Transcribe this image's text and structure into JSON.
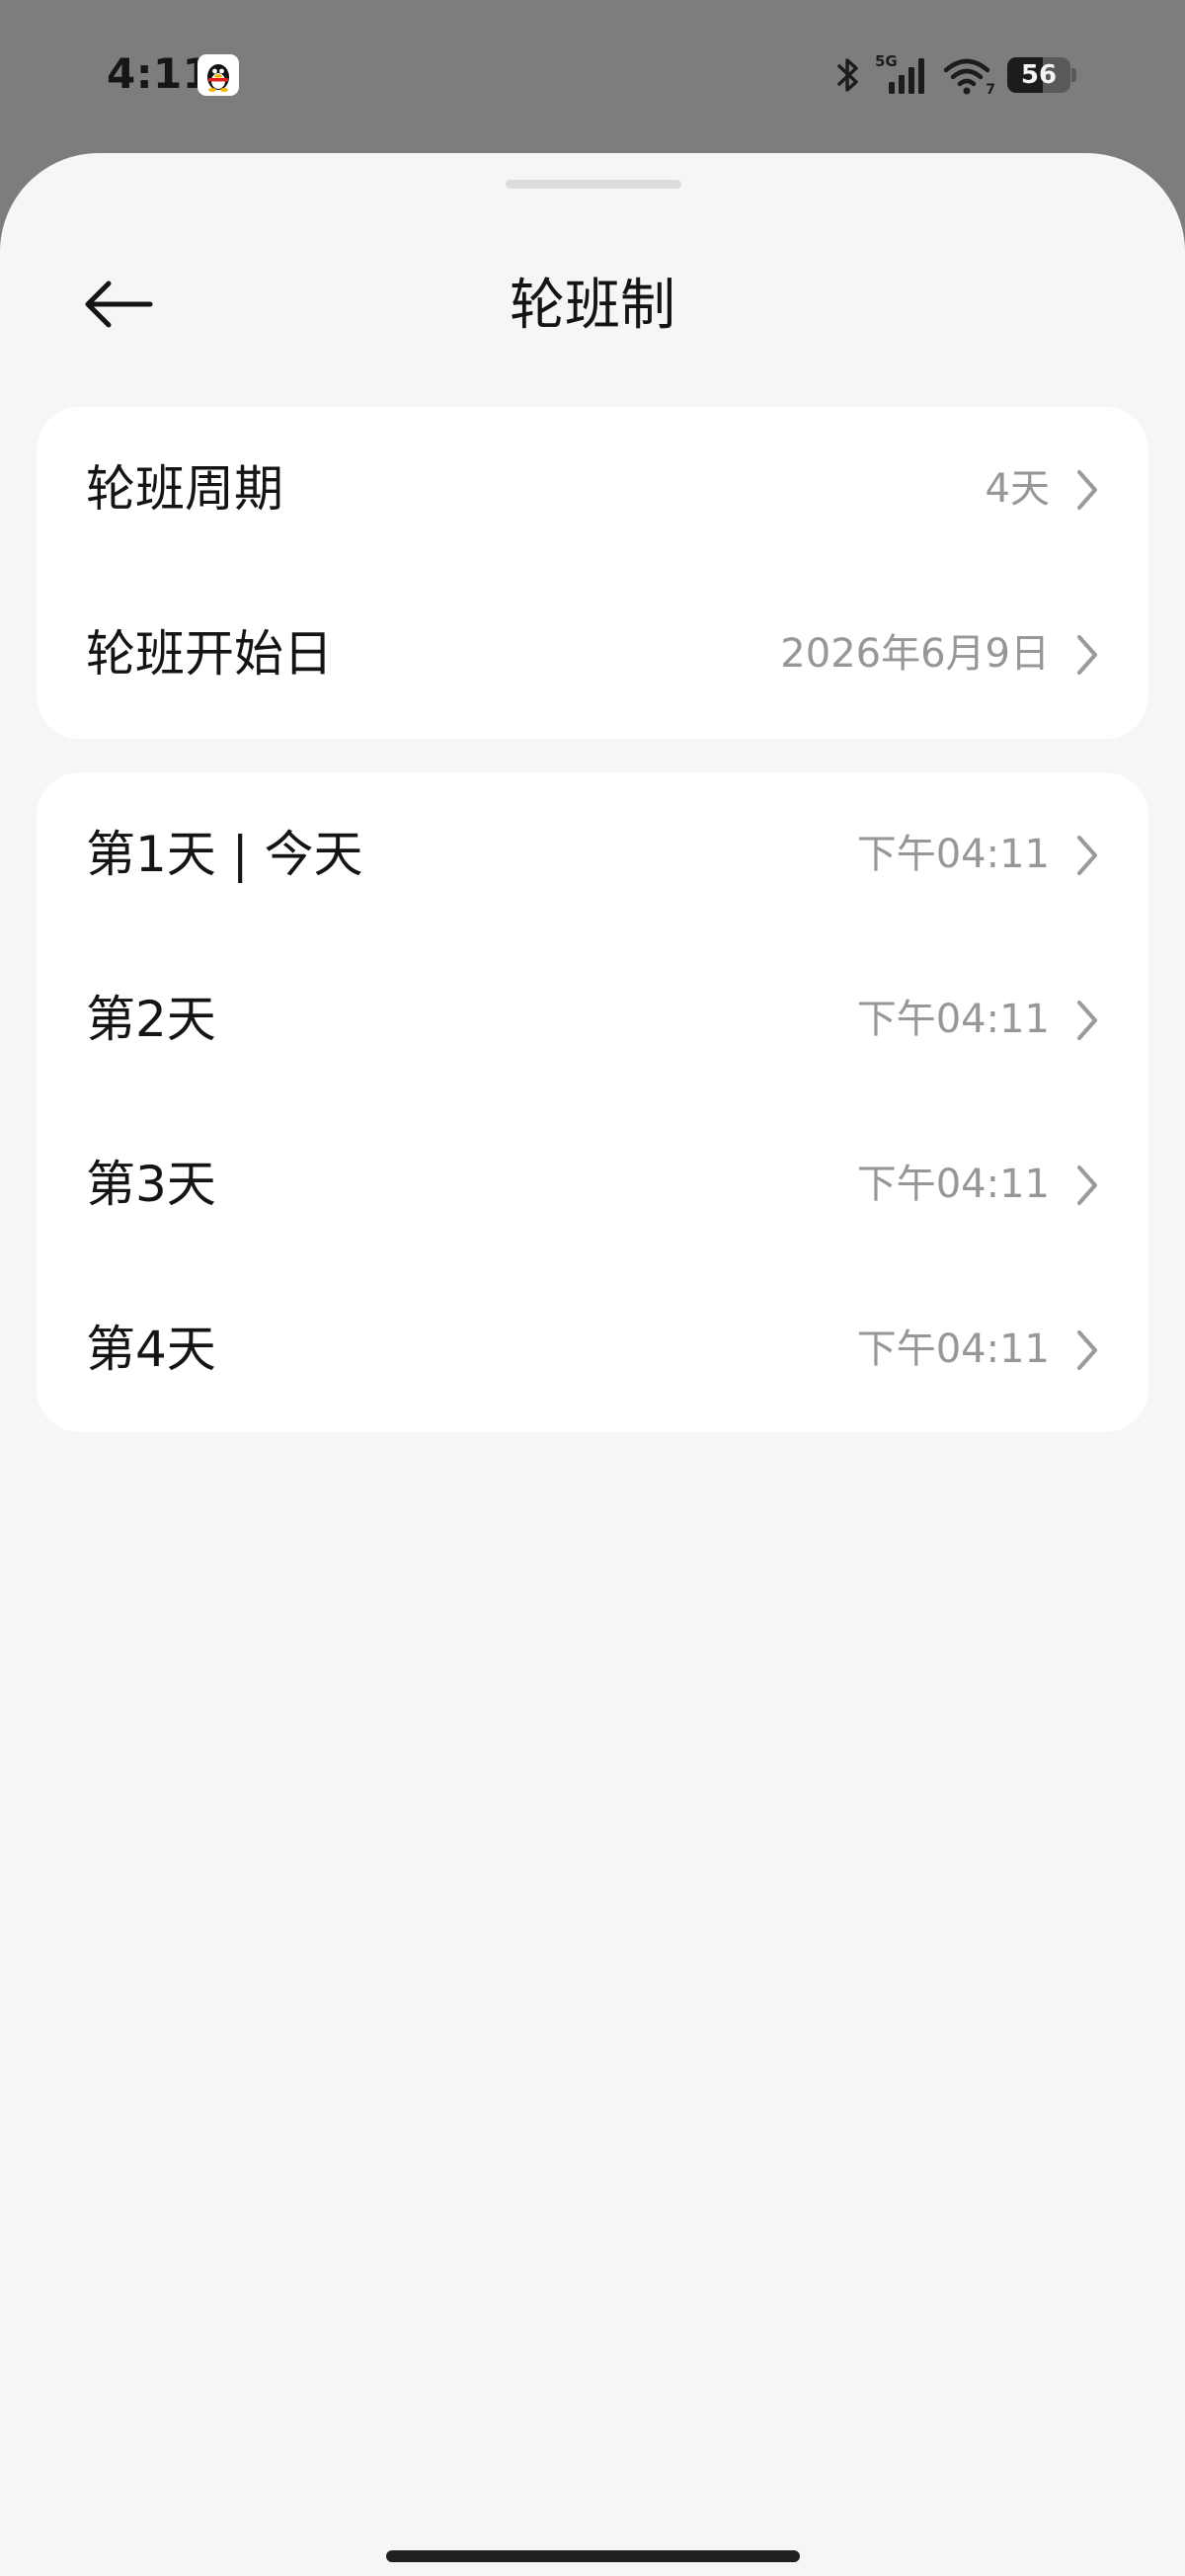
{
  "status_bar": {
    "time": "4:11",
    "network": "5G",
    "wifi_badge": "7",
    "battery_percent": "56",
    "battery_level": 0.56
  },
  "header": {
    "title": "轮班制",
    "back_icon": "arrow-left-icon"
  },
  "settings": {
    "cycle_label": "轮班周期",
    "cycle_value": "4天",
    "start_label": "轮班开始日",
    "start_value": "2026年6月9日"
  },
  "days": [
    {
      "label": "第1天 | 今天",
      "time": "下午04:11"
    },
    {
      "label": "第2天",
      "time": "下午04:11"
    },
    {
      "label": "第3天",
      "time": "下午04:11"
    },
    {
      "label": "第4天",
      "time": "下午04:11"
    }
  ],
  "colors": {
    "sheet_background": "#f6f6f6",
    "card_background": "#ffffff",
    "scrim": "#7d7d7d",
    "primary_text": "#141414",
    "secondary_text": "#979797"
  }
}
